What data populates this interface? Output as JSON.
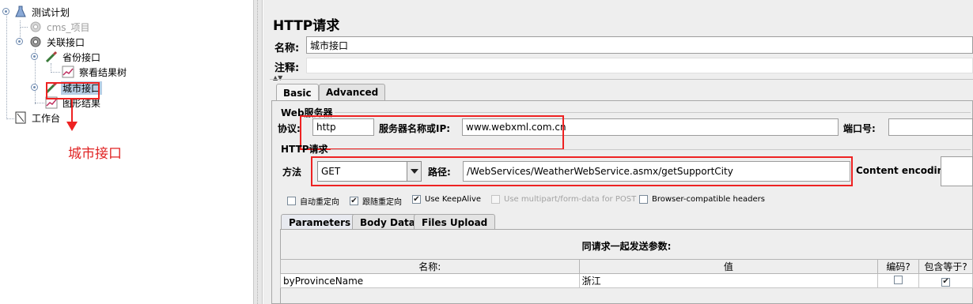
{
  "tree": {
    "items": [
      {
        "label": "测试计划"
      },
      {
        "label": "cms_项目"
      },
      {
        "label": "关联接口"
      },
      {
        "label": "省份接口"
      },
      {
        "label": "察看结果树"
      },
      {
        "label": "城市接口"
      },
      {
        "label": "图形结果"
      },
      {
        "label": "工作台"
      }
    ],
    "annotation": "城市接口"
  },
  "panel": {
    "title": "HTTP请求",
    "name_label": "名称:",
    "name_value": "城市接口",
    "comment_label": "注释:",
    "comment_value": "",
    "tabs": [
      {
        "label": "Basic"
      },
      {
        "label": "Advanced"
      }
    ],
    "web_server": {
      "group_title": "Web服务器",
      "protocol_label": "协议:",
      "protocol_value": "http",
      "server_label": "服务器名称或IP:",
      "server_value": "www.webxml.com.cn",
      "port_label": "端口号:",
      "port_value": ""
    },
    "http_request": {
      "group_title": "HTTP请求",
      "method_label": "方法",
      "method_value": "GET",
      "path_label": "路径:",
      "path_value": "/WebServices/WeatherWebService.asmx/getSupportCity",
      "encoding_label": "Content encoding:",
      "encoding_value": ""
    },
    "options": [
      {
        "label": "自动重定向",
        "checked": false,
        "enabled": true
      },
      {
        "label": "跟随重定向",
        "checked": true,
        "enabled": true
      },
      {
        "label": "Use KeepAlive",
        "checked": true,
        "enabled": true
      },
      {
        "label": "Use multipart/form-data for POST",
        "checked": false,
        "enabled": false
      },
      {
        "label": "Browser-compatible headers",
        "checked": false,
        "enabled": true
      }
    ],
    "param_tabs": [
      {
        "label": "Parameters"
      },
      {
        "label": "Body Data"
      },
      {
        "label": "Files Upload"
      }
    ],
    "params": {
      "caption": "同请求一起发送参数:",
      "columns": [
        "名称:",
        "值",
        "编码?",
        "包含等于?"
      ],
      "rows": [
        {
          "name": "byProvinceName",
          "value": "浙江",
          "encode": false,
          "include_equals": true
        }
      ]
    }
  },
  "colors": {
    "annotation": "#e22222",
    "selected": "#b8cfe5"
  }
}
